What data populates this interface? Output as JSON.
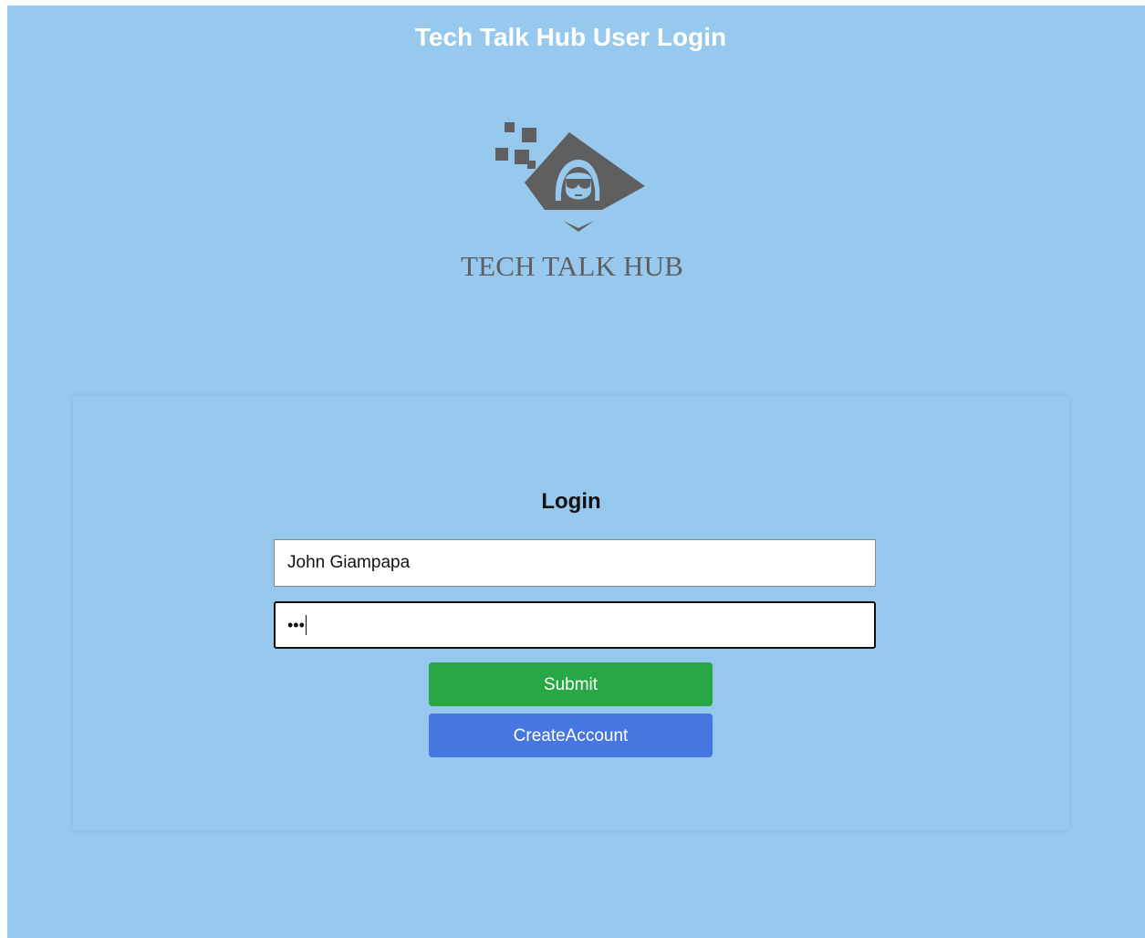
{
  "header": {
    "title": "Tech Talk Hub User Login"
  },
  "logo": {
    "icon": "hooded-hacker-icon",
    "text": "TECH TALK HUB",
    "color": "#5f5f5f"
  },
  "login": {
    "heading": "Login",
    "username_value": "John Giampapa",
    "password_masked": "•••",
    "submit_label": "Submit",
    "create_account_label": "CreateAccount"
  },
  "colors": {
    "background": "#97c9ee",
    "submit": "#28a745",
    "create_account": "#4677e0"
  }
}
